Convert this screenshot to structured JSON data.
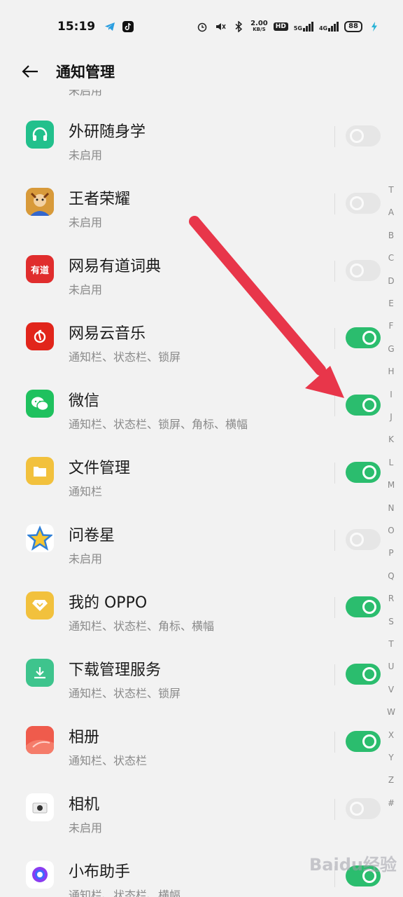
{
  "status_bar": {
    "time": "15:19",
    "speed_value": "2.00",
    "speed_unit": "KB/S",
    "hd_badge": "HD",
    "net1": "5G",
    "net2": "4G",
    "battery": "88"
  },
  "header": {
    "title": "通知管理"
  },
  "partial_top_sub": "未启用",
  "apps": [
    {
      "name": "外研随身学",
      "status": "未启用",
      "enabled": false,
      "icon": "headphones-icon",
      "color": "#22c08c"
    },
    {
      "name": "王者荣耀",
      "status": "未启用",
      "enabled": false,
      "icon": "game-hero-icon",
      "color": "#c88a2c"
    },
    {
      "name": "网易有道词典",
      "status": "未启用",
      "enabled": false,
      "icon": "youdao-icon",
      "color": "#e02d2d",
      "icon_text": "有道"
    },
    {
      "name": "网易云音乐",
      "status": "通知栏、状态栏、锁屏",
      "enabled": true,
      "icon": "netease-music-icon",
      "color": "#e1251b"
    },
    {
      "name": "微信",
      "status": "通知栏、状态栏、锁屏、角标、横幅",
      "enabled": true,
      "icon": "wechat-icon",
      "color": "#1fc15e"
    },
    {
      "name": "文件管理",
      "status": "通知栏",
      "enabled": true,
      "icon": "folder-icon",
      "color": "#f2c13d"
    },
    {
      "name": "问卷星",
      "status": "未启用",
      "enabled": false,
      "icon": "star-icon",
      "color": "#ffffff"
    },
    {
      "name": "我的 OPPO",
      "status": "通知栏、状态栏、角标、横幅",
      "enabled": true,
      "icon": "diamond-icon",
      "color": "#f2c13d"
    },
    {
      "name": "下载管理服务",
      "status": "通知栏、状态栏、锁屏",
      "enabled": true,
      "icon": "download-icon",
      "color": "#3ec48d"
    },
    {
      "name": "相册",
      "status": "通知栏、状态栏",
      "enabled": true,
      "icon": "photos-icon",
      "color": "#ef5b4c"
    },
    {
      "name": "相机",
      "status": "未启用",
      "enabled": false,
      "icon": "camera-icon",
      "color": "#ffffff"
    },
    {
      "name": "小布助手",
      "status": "通知栏、状态栏、横幅",
      "enabled": true,
      "icon": "assistant-icon",
      "color": "#ffffff"
    }
  ],
  "alpha_index": [
    "T",
    "A",
    "B",
    "C",
    "D",
    "E",
    "F",
    "G",
    "H",
    "I",
    "J",
    "K",
    "L",
    "M",
    "N",
    "O",
    "P",
    "Q",
    "R",
    "S",
    "T",
    "U",
    "V",
    "W",
    "X",
    "Y",
    "Z",
    "#"
  ],
  "watermark": "Baidu经验",
  "colors": {
    "toggle_on": "#2bbd6e",
    "toggle_off": "#e6e6e6",
    "arrow": "#e8364a"
  }
}
